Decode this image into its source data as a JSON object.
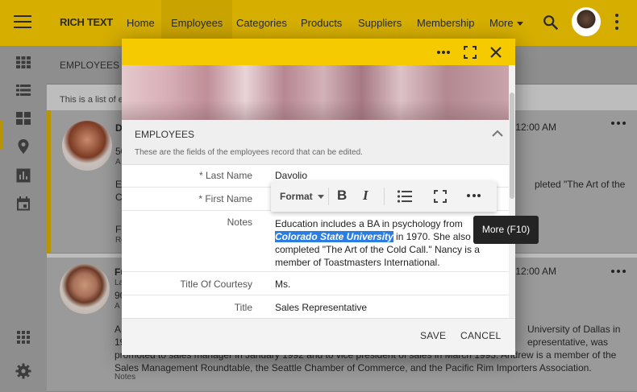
{
  "app": {
    "brand": "RICH TEXT",
    "nav": [
      "Home",
      "Employees",
      "Categories",
      "Products",
      "Suppliers",
      "Membership"
    ],
    "nav_more": "More",
    "active_nav": "Employees"
  },
  "content": {
    "title": "EMPLOYEES (9",
    "description": "This is a list of e",
    "cards": [
      {
        "name_initial": "D",
        "line2": "50",
        "line3": "A",
        "time": "12:00 AM",
        "body_left": "Ed",
        "body_left2": "C",
        "body_right": "pleted \"The Art of the",
        "foot_left": "Fo",
        "foot_left2": "Re"
      },
      {
        "name_initial": "Fu",
        "line2": "La",
        "line3": "90",
        "line4": "A",
        "time": "12:00 AM",
        "body_line1_left": "A",
        "body_line1_right": "University of Dallas in",
        "body_line2_left": "19",
        "body_line2_right": "epresentative, was",
        "body_line3": "promoted to sales manager in January 1992 and to vice president of sales in March 1993. Andrew is a member of the",
        "body_line4": "Sales Management Roundtable, the Seattle Chamber of Commerce, and the Pacific Rim Importers Association.",
        "notes_label": "Notes"
      }
    ]
  },
  "modal": {
    "section_title": "EMPLOYEES",
    "section_desc": "These are the fields of the employees record that can be edited.",
    "fields": {
      "last_name_label": "* Last Name",
      "last_name_value": "Davolio",
      "first_name_label": "* First Name",
      "notes_label": "Notes",
      "notes_line1": "Education includes a BA in psychology from",
      "notes_selected": "Colorado State University",
      "notes_after_sel": " in 1970. She also",
      "notes_line3": "completed \"The Art of the Cold Call.\" Nancy is a",
      "notes_line4": "member of Toastmasters International.",
      "courtesy_label": "Title Of Courtesy",
      "courtesy_value": "Ms.",
      "title_label": "Title",
      "title_value": "Sales Representative"
    },
    "save_label": "SAVE",
    "cancel_label": "CANCEL"
  },
  "toolbar": {
    "format_label": "Format",
    "bold_label": "B",
    "italic_label": "I",
    "tooltip": "More (F10)"
  },
  "icons": {
    "menu": "hamburger-icon",
    "search": "search-icon",
    "more": "more-vertical-icon",
    "fullscreen": "fullscreen-icon",
    "close": "close-icon",
    "collapse": "chevron-up-icon",
    "list": "bulleted-list-icon"
  },
  "colors": {
    "accent": "#f5cb00",
    "accent_dim": "#d5ae00",
    "selection": "#2a7de1",
    "tooltip_bg": "#242424"
  }
}
